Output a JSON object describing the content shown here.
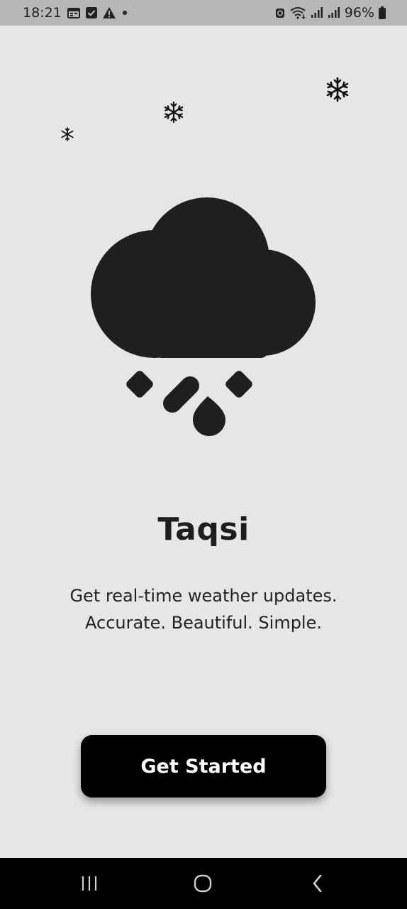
{
  "status_bar": {
    "time": "18:21",
    "battery": "96%",
    "icons": [
      "calendar-icon",
      "check-box-icon",
      "warning-icon",
      "dot-icon",
      "alarm-icon",
      "wifi-icon",
      "signal-icon",
      "signal-icon",
      "battery-icon"
    ]
  },
  "onboarding": {
    "title": "Taqsi",
    "tagline_line1": "Get real-time weather updates.",
    "tagline_line2": "Accurate. Beautiful. Simple.",
    "cta_label": "Get Started",
    "hero_icon": "cloud-hail-icon",
    "decor_icons": [
      "snowflake-icon",
      "snowflake-icon",
      "snowflake-icon"
    ]
  },
  "nav_bar": {
    "buttons": [
      "recent-apps-icon",
      "home-icon",
      "back-icon"
    ]
  },
  "colors": {
    "background": "#e6e6e6",
    "status_bar": "#b7b7b7",
    "button": "#000000",
    "icon": "#1f1f1f",
    "text": "#1e1e1e"
  }
}
